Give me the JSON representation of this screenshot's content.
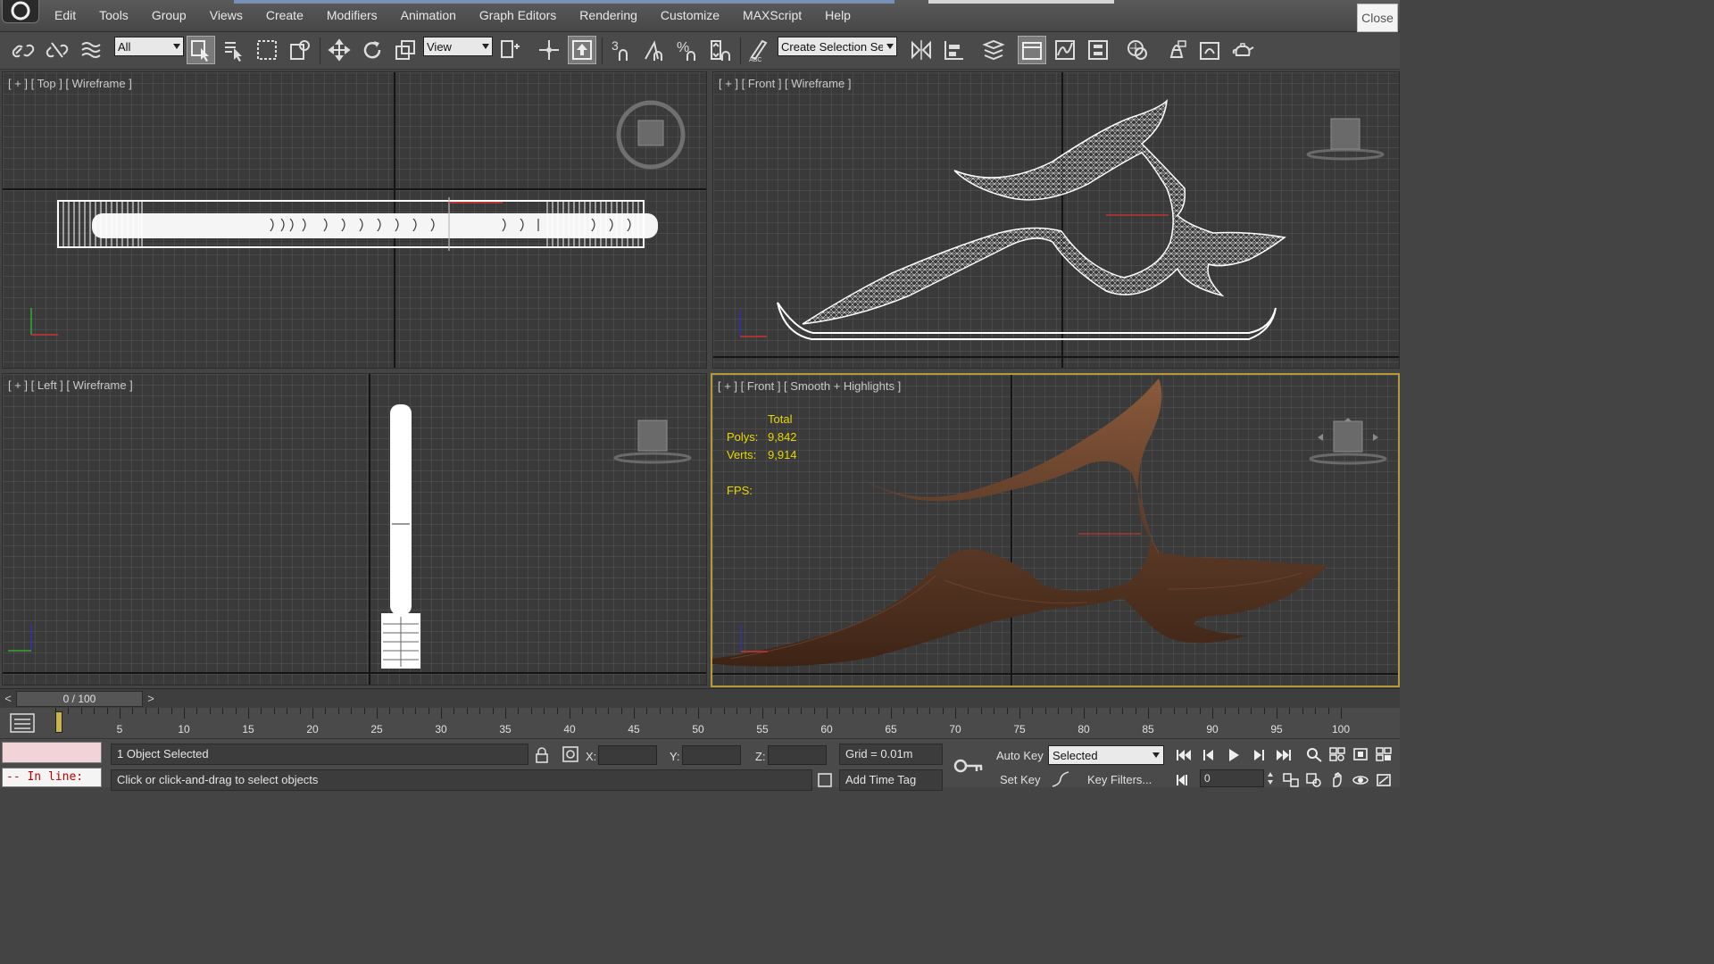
{
  "menu": {
    "items": [
      "Edit",
      "Tools",
      "Group",
      "Views",
      "Create",
      "Modifiers",
      "Animation",
      "Graph Editors",
      "Rendering",
      "Customize",
      "MAXScript",
      "Help"
    ],
    "close_label": "Close"
  },
  "toolbar": {
    "selection_filter": "All",
    "reference_coord": "View",
    "named_selection": "Create Selection Se",
    "snap_label": "3",
    "percent_label": "%"
  },
  "viewports": {
    "top": {
      "label": "[ + ] [ Top ] [ Wireframe ]"
    },
    "front_wire": {
      "label": "[ + ] [ Front ] [ Wireframe ]"
    },
    "left": {
      "label": "[ + ] [ Left ] [ Wireframe ]"
    },
    "front_shaded": {
      "label": "[ + ] [ Front ] [ Smooth + Highlights ]",
      "stats": {
        "header": "Total",
        "polys_label": "Polys:",
        "polys_value": "9,842",
        "verts_label": "Verts:",
        "verts_value": "9,914",
        "fps_label": "FPS:"
      }
    }
  },
  "timeslider": {
    "prev": "<",
    "next": ">",
    "position": "0 / 100",
    "current_frame": 0,
    "total_frames": 100
  },
  "trackbar": {
    "ticks": [
      5,
      10,
      15,
      20,
      25,
      30,
      35,
      40,
      45,
      50,
      55,
      60,
      65,
      70,
      75,
      80,
      85,
      90,
      95,
      100
    ]
  },
  "status": {
    "selection_info": "1 Object Selected",
    "prompt": "Click or click-and-drag to select objects",
    "x_label": "X:",
    "y_label": "Y:",
    "z_label": "Z:",
    "grid": "Grid = 0.01m",
    "add_time_tag": "Add Time Tag",
    "auto_key": "Auto Key",
    "set_key": "Set Key",
    "key_mode": "Selected",
    "key_filters": "Key Filters...",
    "current_frame": "0",
    "listener_inline": "-- In line:"
  },
  "colors": {
    "wood": "#5e3c28",
    "wood_dark": "#3e2416",
    "wood_light": "#8a5a3c",
    "stats_yellow": "#e8d600",
    "active_border": "#b59a38"
  }
}
